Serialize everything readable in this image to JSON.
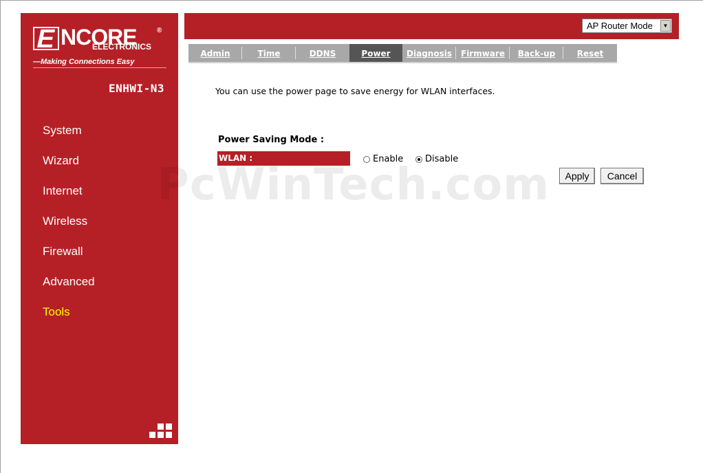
{
  "brand": {
    "logo_mark": "E",
    "logo_word": "NCORE",
    "logo_sub": "ELECTRONICS",
    "logo_reg": "®",
    "tagline": "—Making Connections Easy",
    "model": "ENHWI-N3"
  },
  "sidebar": {
    "items": [
      {
        "label": "System"
      },
      {
        "label": "Wizard"
      },
      {
        "label": "Internet"
      },
      {
        "label": "Wireless"
      },
      {
        "label": "Firewall"
      },
      {
        "label": "Advanced"
      },
      {
        "label": "Tools",
        "active": true
      }
    ]
  },
  "header": {
    "mode_select": {
      "value": "AP Router Mode"
    }
  },
  "tabs": [
    {
      "label": "Admin"
    },
    {
      "label": "Time"
    },
    {
      "label": "DDNS"
    },
    {
      "label": "Power",
      "active": true
    },
    {
      "label": "Diagnosis"
    },
    {
      "label": "Firmware"
    },
    {
      "label": "Back-up"
    },
    {
      "label": "Reset"
    }
  ],
  "content": {
    "description": "You can use the power page to save energy for WLAN interfaces.",
    "section_label": "Power Saving Mode :",
    "wlan_label": "WLAN :",
    "enable_label": "Enable",
    "disable_label": "Disable",
    "selected": "Disable",
    "apply_label": "Apply",
    "cancel_label": "Cancel"
  },
  "watermark": "PcWinTech.com",
  "colors": {
    "brand_red": "#b52026",
    "active_nav": "#ffff00",
    "tab_bg": "#a8a8a8",
    "tab_active": "#555555"
  }
}
